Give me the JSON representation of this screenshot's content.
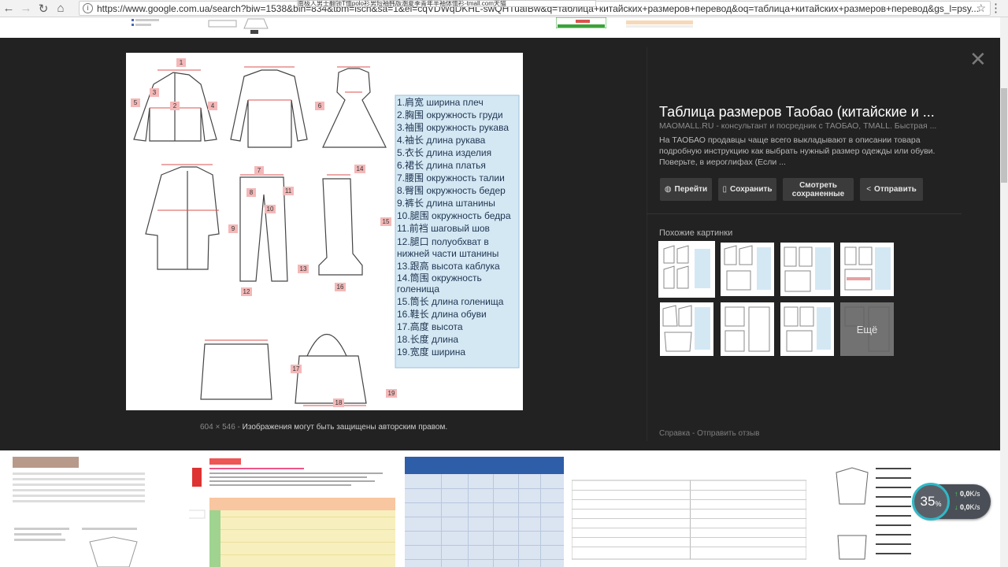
{
  "browser": {
    "back_icon": "arrow-left-icon",
    "forward_icon": "arrow-right-icon",
    "reload_icon": "reload-icon",
    "home_icon": "home-icon",
    "url": "https://www.google.com.ua/search?biw=1538&bih=834&tbm=isch&sa=1&ei=cqVDWqDKHL-swQHTuaIBw&q=таблица+китайских+размеров+перевод&oq=таблица+китайских+размеров+перевод&gs_l=psy...",
    "tooltip_text": "南极人男士翻领T恤polo衫男短袖韩版潮夏季青年半袖体恤衫-tmall.com天猫"
  },
  "viewer": {
    "image_dims": "604 × 546",
    "image_copyright": "Изображения могут быть защищены авторским правом.",
    "title": "Таблица размеров Таобао (китайские и ...",
    "source": "MAOMALL.RU - консультант и посредник с ТАОБАО, TMALL. Быстрая ...",
    "description": "На ТАОБАО продавцы чаще всего выкладывают в описании товара подробную инструкцию как выбрать нужный размер одежды или обуви. Поверьте, в иероглифах (Если ...",
    "actions": [
      {
        "label": "Перейти",
        "icon": "globe-icon"
      },
      {
        "label": "Сохранить",
        "icon": "bookmark-icon"
      },
      {
        "label": "Смотреть сохраненные",
        "icon": ""
      },
      {
        "label": "Отправить",
        "icon": "share-icon"
      }
    ],
    "similar_title": "Похожие картинки",
    "more_label": "Ещё",
    "footer_help": "Справка",
    "footer_feedback": "Отправить отзыв",
    "close_icon": "close-icon"
  },
  "size_legend": [
    "1.肩宽 ширина плеч",
    "2.胸围 окружность груди",
    "3.袖围 окружность рукава",
    "4.袖长 длина рукава",
    "5.衣长 длина изделия",
    "6.裙长 длина платья",
    "7.腰围 окружность талии",
    "8.臀围 окружность бедер",
    "9.裤长 длина штанины",
    "10.腿围 окружность бедра",
    "11.前裆 шаговый шов",
    "12.腿口 полуобхват в",
    "нижней части штанины",
    "13.跟高 высота каблука",
    "14.筒围 окружность",
    "голенища",
    "15.筒长 длина голенища",
    "16.鞋长 длина обуви",
    "17.高度 высота",
    "18.长度 длина",
    "19.宽度 ширина"
  ],
  "diagram_numbers": [
    "1",
    "2",
    "3",
    "4",
    "5",
    "6",
    "7",
    "8",
    "9",
    "10",
    "11",
    "12",
    "13",
    "14",
    "15",
    "16",
    "17",
    "18",
    "19"
  ],
  "speed_widget": {
    "percent": "35",
    "percent_unit": "%",
    "upload": "0,0",
    "download": "0,0",
    "unit": "K/s"
  }
}
